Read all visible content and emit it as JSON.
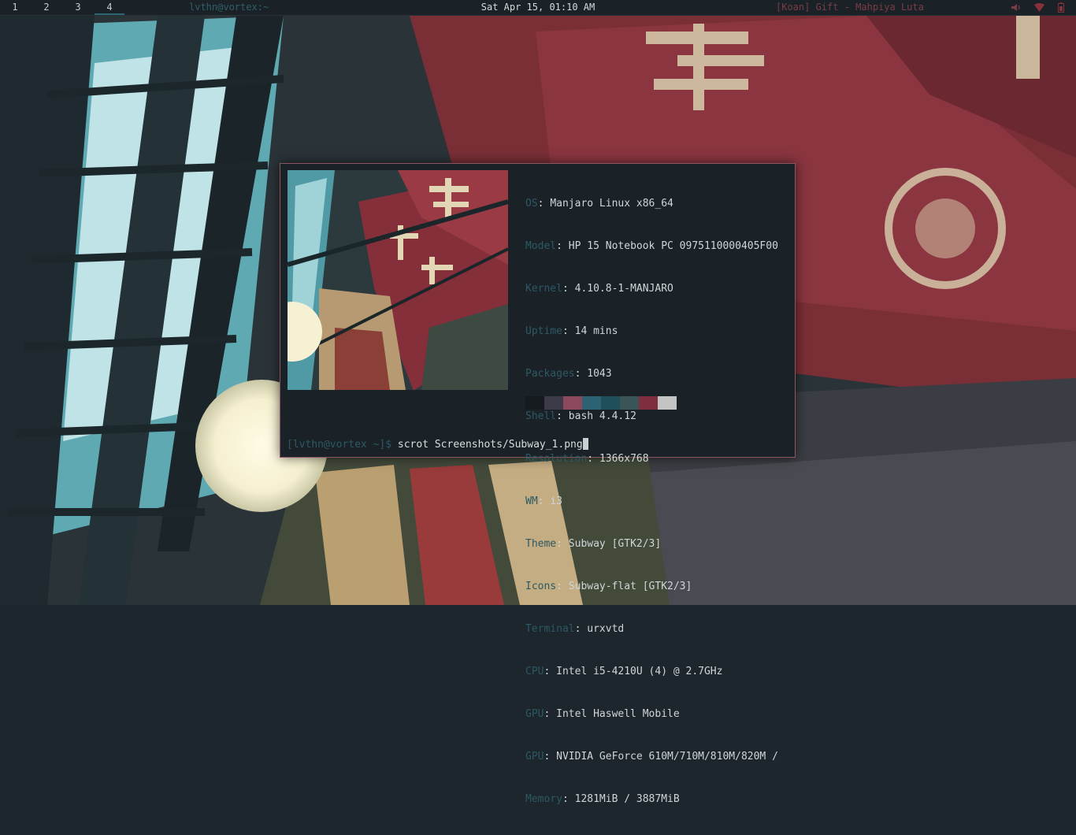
{
  "bar": {
    "workspaces": [
      "1",
      "2",
      "3",
      "4"
    ],
    "active_workspace": "4",
    "window_title": "lvthn@vortex:~",
    "clock": "Sat Apr 15, 01:10 AM",
    "now_playing": "[Koan] Gift - Mahpiya Luta",
    "tray_icons": [
      "volume-icon",
      "wifi-icon",
      "battery-icon"
    ],
    "accent": "#2c6670",
    "music_color": "#7a3c46"
  },
  "terminal": {
    "info": [
      {
        "key": "OS",
        "value": "Manjaro Linux x86_64"
      },
      {
        "key": "Model",
        "value": "HP 15 Notebook PC 0975110000405F00"
      },
      {
        "key": "Kernel",
        "value": "4.10.8-1-MANJARO"
      },
      {
        "key": "Uptime",
        "value": "14 mins"
      },
      {
        "key": "Packages",
        "value": "1043"
      },
      {
        "key": "Shell",
        "value": "bash 4.4.12"
      },
      {
        "key": "Resolution",
        "value": "1366x768"
      },
      {
        "key": "WM",
        "value": "i3"
      },
      {
        "key": "Theme",
        "value": "Subway [GTK2/3]"
      },
      {
        "key": "Icons",
        "value": "Subway-flat [GTK2/3]"
      },
      {
        "key": "Terminal",
        "value": "urxvtd"
      },
      {
        "key": "CPU",
        "value": "Intel i5-4210U (4) @ 2.7GHz"
      },
      {
        "key": "GPU",
        "value": "Intel Haswell Mobile"
      },
      {
        "key": "GPU",
        "value": "NVIDIA GeForce 610M/710M/810M/820M /"
      },
      {
        "key": "Memory",
        "value": "1281MiB / 3887MiB"
      }
    ],
    "palette": [
      "#141a1e",
      "#3c3a47",
      "#8a4a5b",
      "#2c6274",
      "#1f4f5a",
      "#3a5458",
      "#7d2f3e",
      "#c4c4c4"
    ],
    "prompt": "[lvthn@vortex ~]$",
    "command": "scrot Screenshots/Subway_1.png",
    "border_color": "#8b5561",
    "key_color": "#2c5963"
  }
}
